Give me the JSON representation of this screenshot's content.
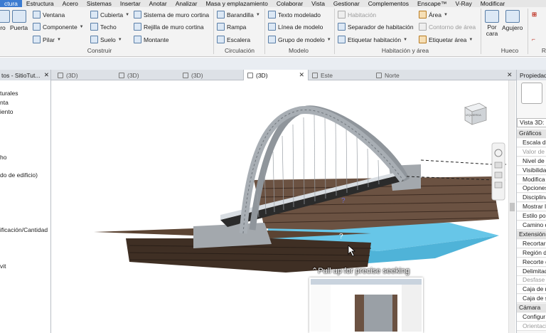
{
  "menu": [
    "ctura",
    "Estructura",
    "Acero",
    "Sistemas",
    "Insertar",
    "Anotar",
    "Analizar",
    "Masa y emplazamiento",
    "Colaborar",
    "Vista",
    "Gestionar",
    "Complementos",
    "Enscape™",
    "V-Ray",
    "Modificar"
  ],
  "ribbon": {
    "left_big": [
      "ro",
      "Puerta"
    ],
    "construir": {
      "ventana": "Ventana",
      "componente": "Componente",
      "pilar": "Pilar",
      "cubierta": "Cubierta",
      "techo": "Techo",
      "suelo": "Suelo",
      "sistema_muro": "Sistema de muro cortina",
      "rejilla_muro": "Rejilla de muro cortina",
      "montante": "Montante",
      "label": "Construir"
    },
    "circulacion": {
      "barandilla": "Barandilla",
      "rampa": "Rampa",
      "escalera": "Escalera",
      "label": "Circulación"
    },
    "modelo": {
      "texto": "Texto modelado",
      "linea": "Línea de modelo",
      "grupo": "Grupo de modelo",
      "label": "Modelo"
    },
    "habitacion": {
      "habitacion": "Habitación",
      "separador": "Separador de habitación",
      "etiquetar_hab": "Etiquetar habitación",
      "area": "Área",
      "contorno": "Contorno de área",
      "etiquetar_area": "Etiquetar área",
      "label": "Habitación y área"
    },
    "hueco": {
      "por_cara": "Por cara",
      "agujero": "Agujero",
      "label": "Hueco"
    },
    "far_right": "R"
  },
  "left_panel": {
    "title": "tos - SitioTut...",
    "items": [
      "turales",
      "nta",
      "iento",
      "ho",
      "do de edificio)",
      "ificación/Cantidad",
      "vit"
    ]
  },
  "tabs": [
    {
      "label": "(3D)",
      "active": false
    },
    {
      "label": "(3D)",
      "active": false
    },
    {
      "label": "(3D)",
      "active": false
    },
    {
      "label": "(3D)",
      "active": true
    },
    {
      "label": "Este",
      "active": false
    },
    {
      "label": "Norte",
      "active": false
    }
  ],
  "viewcube_label": "IZQUIERDA",
  "properties": {
    "title": "Propiedad",
    "type_selector": "Vista 3D: (",
    "rows": [
      {
        "text": "Gráficos",
        "kind": "cat"
      },
      {
        "text": "Escala de",
        "kind": "row"
      },
      {
        "text": "Valor de e",
        "kind": "dim"
      },
      {
        "text": "Nivel de d",
        "kind": "row"
      },
      {
        "text": "Visibilida",
        "kind": "row"
      },
      {
        "text": "Modifica",
        "kind": "row"
      },
      {
        "text": "Opciones",
        "kind": "row"
      },
      {
        "text": "Disciplina",
        "kind": "row"
      },
      {
        "text": "Mostrar l",
        "kind": "row"
      },
      {
        "text": "Estilo por",
        "kind": "row"
      },
      {
        "text": "Camino d",
        "kind": "row"
      },
      {
        "text": "Extensión",
        "kind": "cat"
      },
      {
        "text": "Recortar",
        "kind": "row"
      },
      {
        "text": "Región d",
        "kind": "row"
      },
      {
        "text": "Recorte d",
        "kind": "row"
      },
      {
        "text": "Delimitad",
        "kind": "row"
      },
      {
        "text": "Desfase d",
        "kind": "dim"
      },
      {
        "text": "Caja de r",
        "kind": "row"
      },
      {
        "text": "Caja de s",
        "kind": "row"
      },
      {
        "text": "Cámara",
        "kind": "cat"
      },
      {
        "text": "Configur",
        "kind": "row"
      },
      {
        "text": "Orientaci",
        "kind": "dim"
      }
    ]
  },
  "seek_overlay": "⌃Pull up for precise seeking",
  "colors": {
    "menu_active": "#3b7bd1",
    "water": "#67c6e8",
    "deck": "#5b4433",
    "arch": "#9aa0a6"
  }
}
